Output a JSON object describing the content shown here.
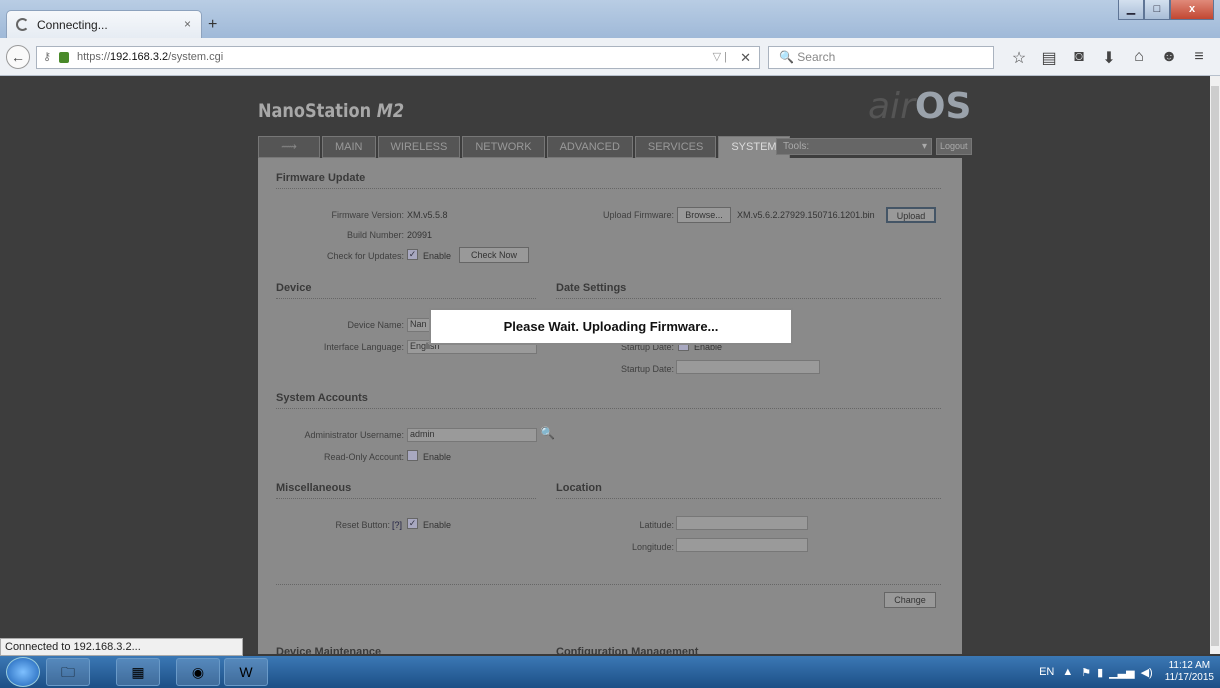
{
  "browser": {
    "tab_title": "Connecting...",
    "url_host": "192.168.3.2",
    "url_prefix": "https://",
    "url_path": "/system.cgi",
    "search_placeholder": "Search"
  },
  "device": {
    "model": "NanoStation",
    "model_suffix": "M2",
    "brand_prefix": "air",
    "brand_suffix": "OS"
  },
  "nav": {
    "tabs": [
      "MAIN",
      "WIRELESS",
      "NETWORK",
      "ADVANCED",
      "SERVICES",
      "SYSTEM"
    ],
    "tools_label": "Tools:",
    "logout": "Logout"
  },
  "firmware": {
    "title": "Firmware Update",
    "version_label": "Firmware Version:",
    "version": "XM.v5.5.8",
    "build_label": "Build Number:",
    "build": "20991",
    "updates_label": "Check for Updates:",
    "enable": "Enable",
    "check_now": "Check Now",
    "upload_label": "Upload Firmware:",
    "browse": "Browse...",
    "file": "XM.v5.6.2.27929.150716.1201.bin",
    "upload": "Upload"
  },
  "device_sec": {
    "title": "Device",
    "name_label": "Device Name:",
    "name_value": "Nan",
    "lang_label": "Interface Language:",
    "lang_value": "English"
  },
  "date": {
    "title": "Date Settings",
    "startup_label": "Startup Date:",
    "startup_date_label": "Startup Date:",
    "enable": "Enable"
  },
  "accounts": {
    "title": "System Accounts",
    "admin_label": "Administrator Username:",
    "admin": "admin",
    "readonly_label": "Read-Only Account:",
    "enable": "Enable"
  },
  "misc": {
    "title": "Miscellaneous",
    "reset_label": "Reset Button:",
    "help": "[?]",
    "enable": "Enable"
  },
  "location": {
    "title": "Location",
    "lat_label": "Latitude:",
    "lon_label": "Longitude:"
  },
  "change": "Change",
  "maintenance": {
    "title": "Device Maintenance",
    "config": "Configuration Management"
  },
  "dialog": "Please Wait. Uploading Firmware...",
  "status": "Connected to 192.168.3.2...",
  "tray": {
    "lang": "EN",
    "time": "11:12 AM",
    "date": "11/17/2015"
  }
}
